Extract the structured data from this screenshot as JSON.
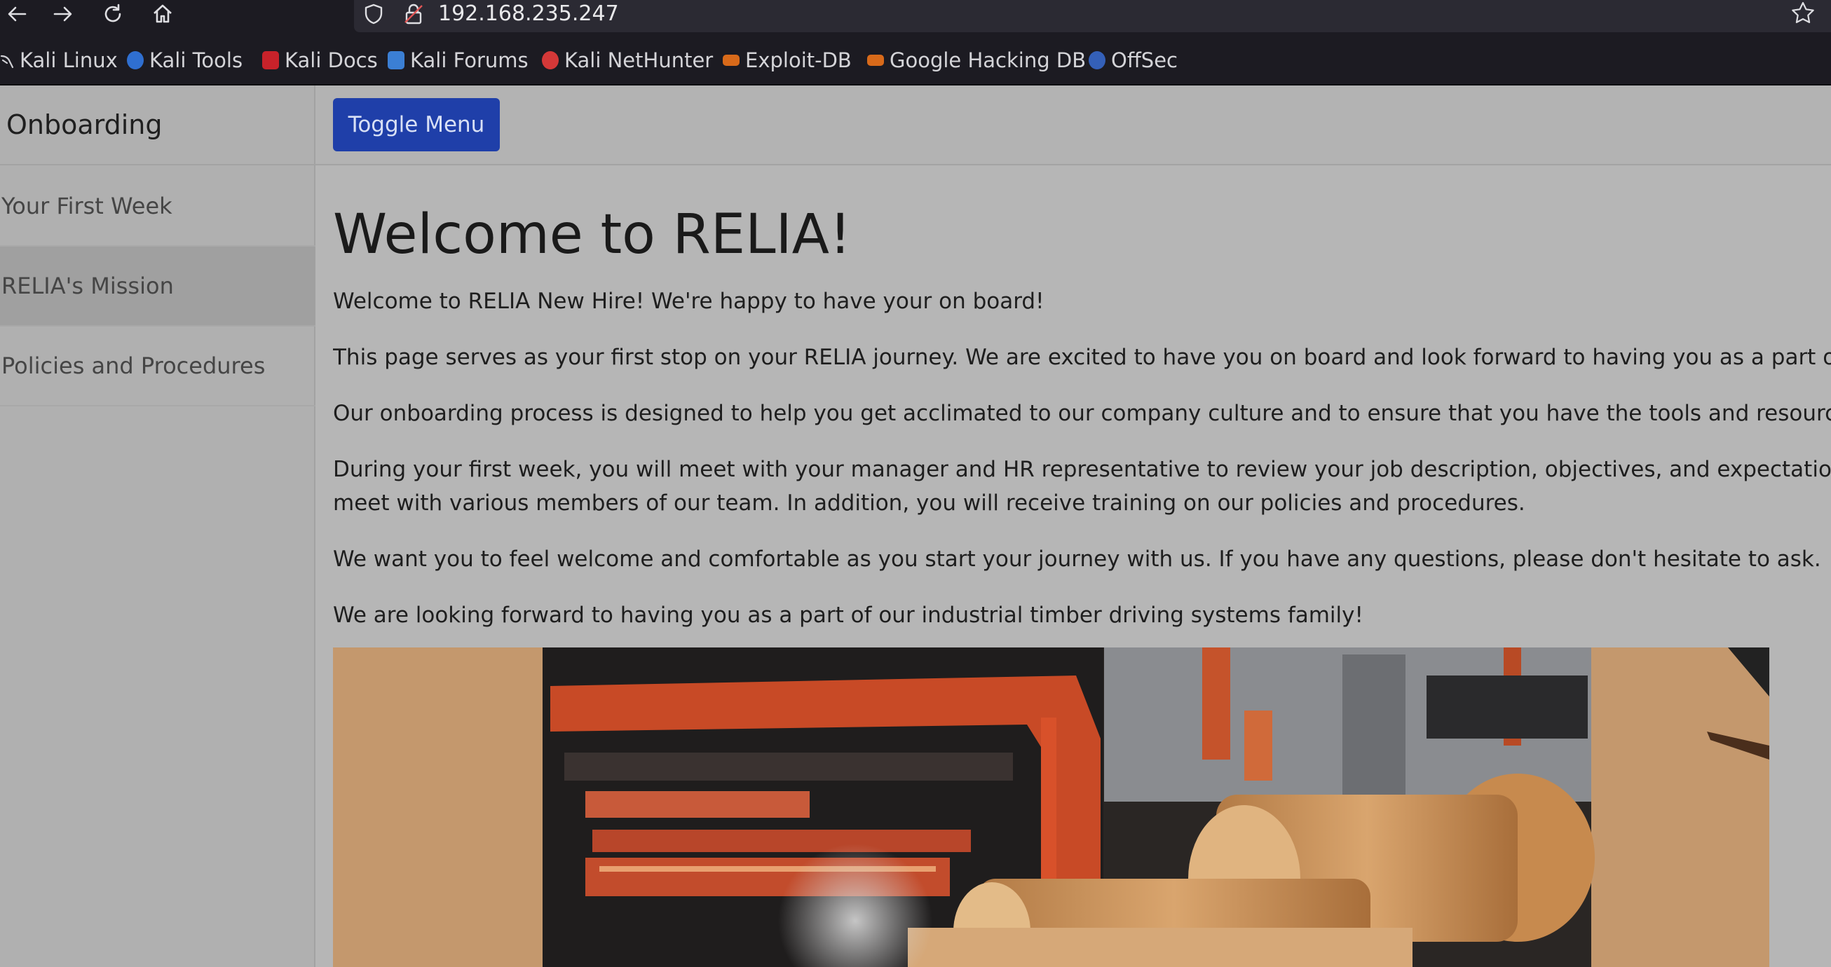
{
  "browser": {
    "url": "192.168.235.247",
    "bookmarks": [
      {
        "label": "Kali Linux",
        "icon": "kali-dragon-icon",
        "color": "#7a7a7a"
      },
      {
        "label": "Kali Tools",
        "icon": "kali-tools-icon",
        "color": "#2f6fd0"
      },
      {
        "label": "Kali Docs",
        "icon": "kali-docs-icon",
        "color": "#c8222a"
      },
      {
        "label": "Kali Forums",
        "icon": "kali-forums-icon",
        "color": "#3b7fd4"
      },
      {
        "label": "Kali NetHunter",
        "icon": "kali-nethunter-icon",
        "color": "#d43838"
      },
      {
        "label": "Exploit-DB",
        "icon": "exploit-db-icon",
        "color": "#d86a1a"
      },
      {
        "label": "Google Hacking DB",
        "icon": "ghdb-icon",
        "color": "#d86a1a"
      },
      {
        "label": "OffSec",
        "icon": "offsec-icon",
        "color": "#3460b8"
      }
    ]
  },
  "sidebar": {
    "heading": "Onboarding",
    "items": [
      {
        "label": "Your First Week",
        "active": false
      },
      {
        "label": "RELIA's Mission",
        "active": true
      },
      {
        "label": "Policies and Procedures",
        "active": false
      }
    ]
  },
  "topnav": {
    "toggle_label": "Toggle Menu",
    "toggle_color": "#1f3fa9"
  },
  "main": {
    "title": "Welcome to RELIA!",
    "paragraphs": [
      "Welcome to RELIA New Hire! We're happy to have your on board!",
      "This page serves as your first stop on your RELIA journey. We are excited to have you on board and look forward to having you as a part of our team.",
      "Our onboarding process is designed to help you get acclimated to our company culture and to ensure that you have the tools and resources you need to",
      "During your first week, you will meet with your manager and HR representative to review your job description, objectives, and expectations. You will also",
      "meet with various members of our team. In addition, you will receive training on our policies and procedures.",
      "We want you to feel welcome and comfortable as you start your journey with us. If you have any questions, please don't hesitate to ask.",
      "We are looking forward to having you as a part of our industrial timber driving systems family!"
    ]
  }
}
